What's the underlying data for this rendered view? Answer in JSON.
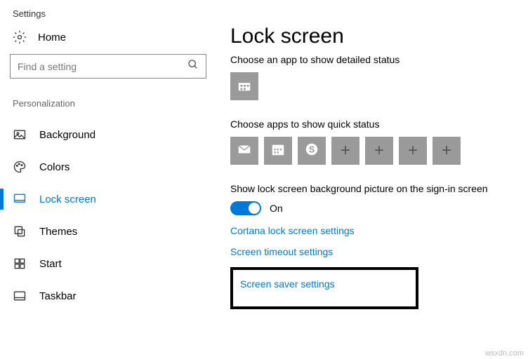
{
  "window": {
    "title": "Settings"
  },
  "sidebar": {
    "home": "Home",
    "search_placeholder": "Find a setting",
    "section": "Personalization",
    "items": [
      {
        "label": "Background"
      },
      {
        "label": "Colors"
      },
      {
        "label": "Lock screen"
      },
      {
        "label": "Themes"
      },
      {
        "label": "Start"
      },
      {
        "label": "Taskbar"
      }
    ]
  },
  "main": {
    "title": "Lock screen",
    "detailed_caption": "Choose an app to show detailed status",
    "quick_caption": "Choose apps to show quick status",
    "signin_caption": "Show lock screen background picture on the sign-in screen",
    "toggle_state": "On",
    "links": {
      "cortana": "Cortana lock screen settings",
      "timeout": "Screen timeout settings",
      "screensaver": "Screen saver settings"
    }
  },
  "watermark": "wsxdn.com"
}
